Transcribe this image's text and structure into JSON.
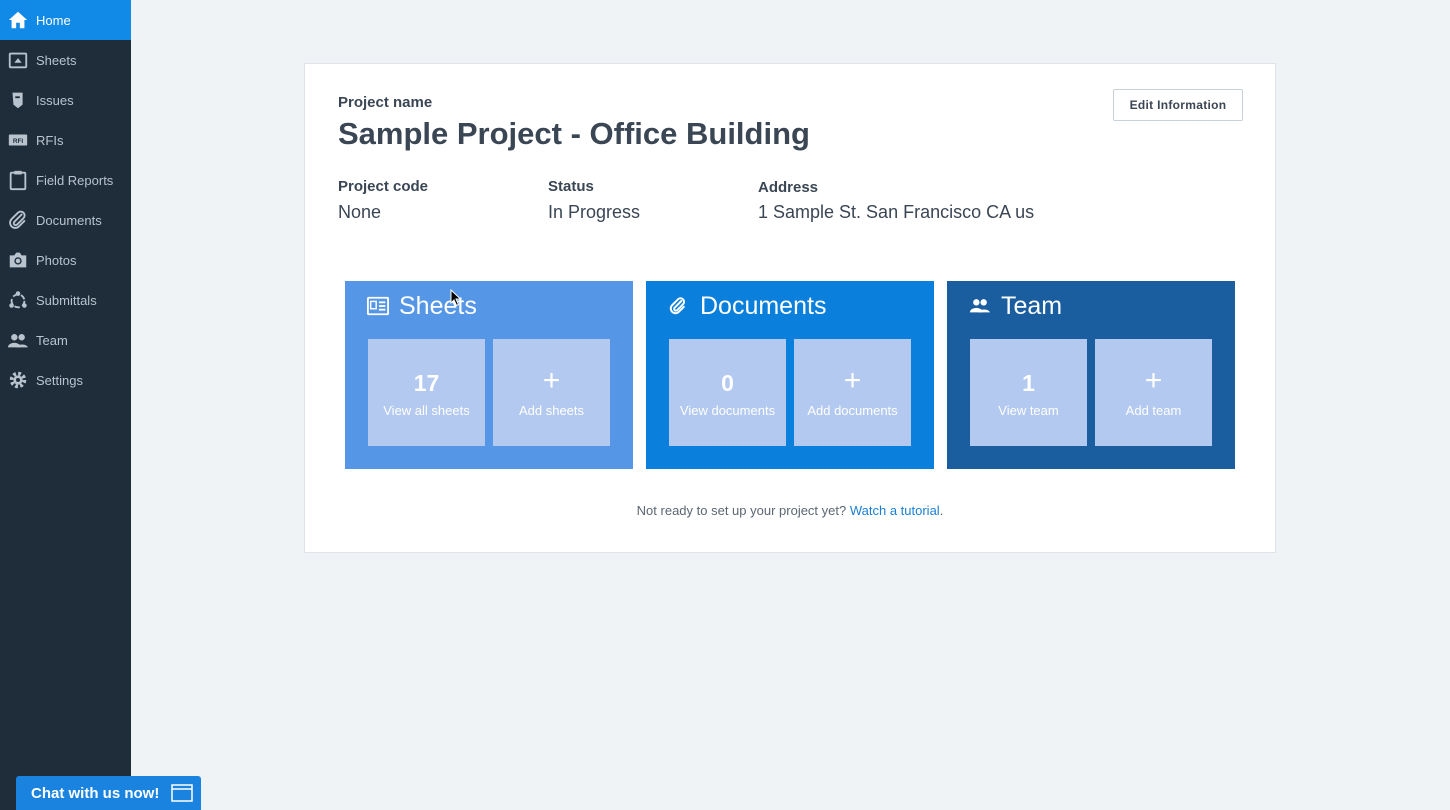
{
  "sidebar": {
    "items": [
      {
        "label": "Home",
        "icon": "home-icon",
        "active": true
      },
      {
        "label": "Sheets",
        "icon": "sheets-icon"
      },
      {
        "label": "Issues",
        "icon": "issues-icon"
      },
      {
        "label": "RFIs",
        "icon": "rfi-icon"
      },
      {
        "label": "Field Reports",
        "icon": "clipboard-icon"
      },
      {
        "label": "Documents",
        "icon": "paperclip-icon"
      },
      {
        "label": "Photos",
        "icon": "camera-icon"
      },
      {
        "label": "Submittals",
        "icon": "submittals-icon"
      },
      {
        "label": "Team",
        "icon": "team-icon"
      },
      {
        "label": "Settings",
        "icon": "gear-icon"
      }
    ]
  },
  "project": {
    "name_label": "Project name",
    "name": "Sample Project - Office Building",
    "edit_label": "Edit Information",
    "code_label": "Project code",
    "code": "None",
    "status_label": "Status",
    "status": "In Progress",
    "address_label": "Address",
    "address": "1 Sample St. San Francisco CA us"
  },
  "panels": [
    {
      "title": "Sheets",
      "icon": "sheets-icon",
      "color": "#5596e6",
      "count": "17",
      "view_label": "View all sheets",
      "add_label": "Add sheets",
      "add_glyph": "+"
    },
    {
      "title": "Documents",
      "icon": "paperclip-icon",
      "color": "#0a7fdb",
      "count": "0",
      "view_label": "View documents",
      "add_label": "Add documents",
      "add_glyph": "+"
    },
    {
      "title": "Team",
      "icon": "team-icon",
      "color": "#1a5ea0",
      "count": "1",
      "view_label": "View team",
      "add_label": "Add team",
      "add_glyph": "+"
    }
  ],
  "footer": {
    "text": "Not ready to set up your project yet?",
    "link": "Watch a tutorial",
    "end": "."
  },
  "chat": {
    "label": "Chat with us now!"
  },
  "colors": {
    "sidebar_bg": "#1f2d3b",
    "active": "#1189e6",
    "tile": "#b3c9ef",
    "link": "#1a7fd4"
  }
}
